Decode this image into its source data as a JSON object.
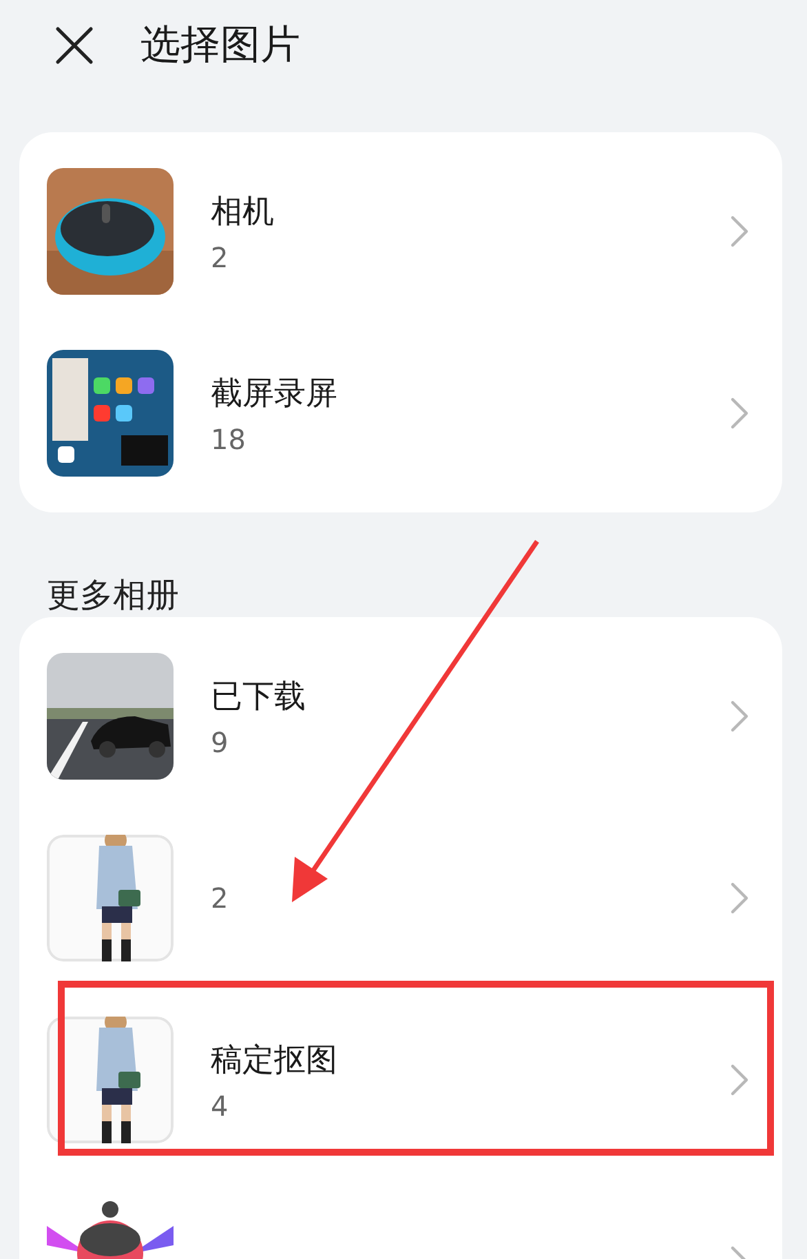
{
  "header": {
    "title": "选择图片"
  },
  "pinned": [
    {
      "name": "相机",
      "count": "2"
    },
    {
      "name": "截屏录屏",
      "count": "18"
    }
  ],
  "more": {
    "heading": "更多相册",
    "albums": [
      {
        "name": "已下载",
        "count": "9",
        "highlighted": false,
        "arrow": false
      },
      {
        "count": "2",
        "highlighted": false,
        "arrow": true
      },
      {
        "name": "稿定抠图",
        "count": "4",
        "highlighted": true,
        "arrow": false
      },
      {
        "highlighted": false,
        "arrow": false
      }
    ]
  }
}
